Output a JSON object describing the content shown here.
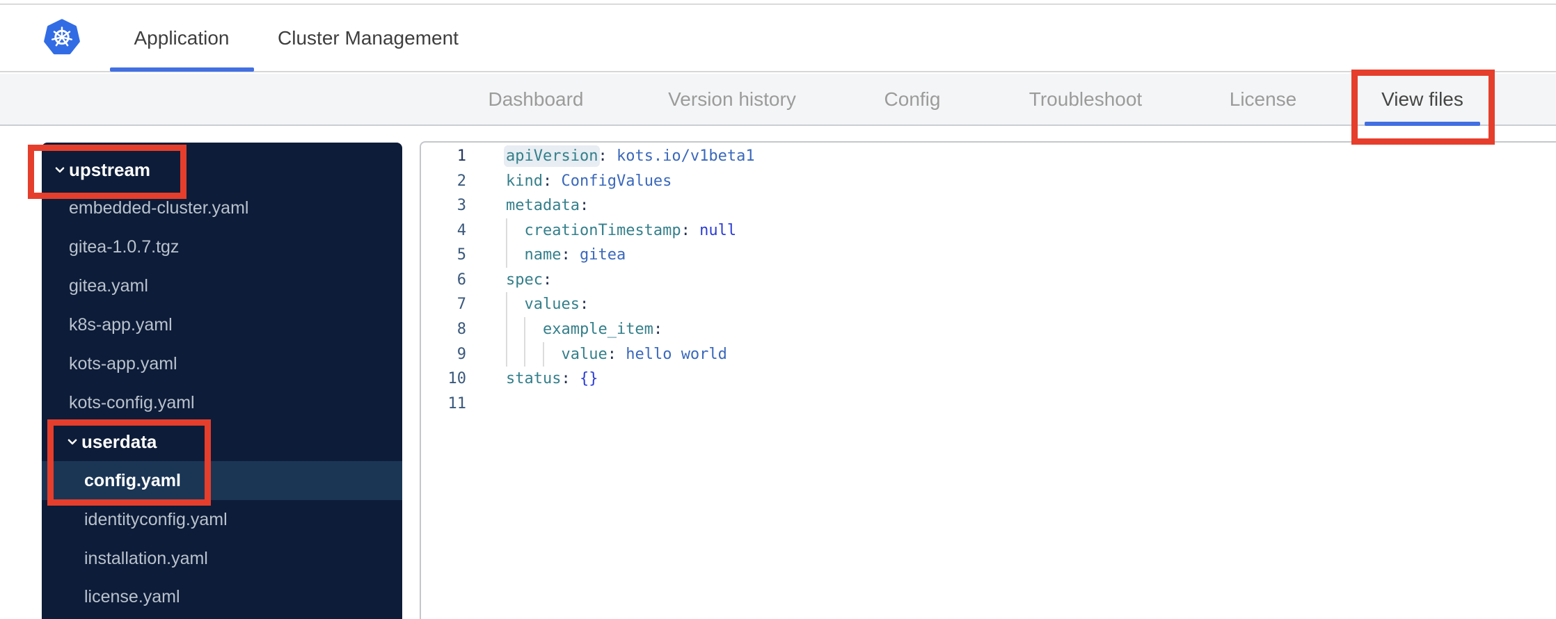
{
  "header": {
    "tabs": [
      {
        "label": "Application",
        "active": true
      },
      {
        "label": "Cluster Management",
        "active": false
      }
    ]
  },
  "nav": {
    "tabs": [
      {
        "label": "Dashboard",
        "active": false
      },
      {
        "label": "Version history",
        "active": false
      },
      {
        "label": "Config",
        "active": false
      },
      {
        "label": "Troubleshoot",
        "active": false
      },
      {
        "label": "License",
        "active": false
      },
      {
        "label": "View files",
        "active": true
      }
    ]
  },
  "sidebar": {
    "items": [
      {
        "label": "upstream",
        "type": "folder",
        "level": 0,
        "expanded": true,
        "selected": false
      },
      {
        "label": "embedded-cluster.yaml",
        "type": "file",
        "level": 1,
        "selected": false
      },
      {
        "label": "gitea-1.0.7.tgz",
        "type": "file",
        "level": 1,
        "selected": false
      },
      {
        "label": "gitea.yaml",
        "type": "file",
        "level": 1,
        "selected": false
      },
      {
        "label": "k8s-app.yaml",
        "type": "file",
        "level": 1,
        "selected": false
      },
      {
        "label": "kots-app.yaml",
        "type": "file",
        "level": 1,
        "selected": false
      },
      {
        "label": "kots-config.yaml",
        "type": "file",
        "level": 1,
        "selected": false
      },
      {
        "label": "userdata",
        "type": "folder",
        "level": 1,
        "expanded": true,
        "selected": false
      },
      {
        "label": "config.yaml",
        "type": "file",
        "level": 2,
        "selected": true
      },
      {
        "label": "identityconfig.yaml",
        "type": "file",
        "level": 2,
        "selected": false
      },
      {
        "label": "installation.yaml",
        "type": "file",
        "level": 2,
        "selected": false
      },
      {
        "label": "license.yaml",
        "type": "file",
        "level": 2,
        "selected": false
      }
    ]
  },
  "editor": {
    "selected_file": "config.yaml",
    "lines": [
      {
        "num": "1",
        "active": true,
        "guides": 0,
        "tokens": [
          {
            "c": "key",
            "t": "apiVersion",
            "hl": true
          },
          {
            "c": "punct",
            "t": ":"
          },
          {
            "c": "plain",
            "t": " "
          },
          {
            "c": "str",
            "t": "kots.io/v1beta1"
          }
        ]
      },
      {
        "num": "2",
        "active": false,
        "guides": 0,
        "tokens": [
          {
            "c": "key",
            "t": "kind"
          },
          {
            "c": "punct",
            "t": ":"
          },
          {
            "c": "plain",
            "t": " "
          },
          {
            "c": "str",
            "t": "ConfigValues"
          }
        ]
      },
      {
        "num": "3",
        "active": false,
        "guides": 0,
        "tokens": [
          {
            "c": "key",
            "t": "metadata"
          },
          {
            "c": "punct",
            "t": ":"
          }
        ]
      },
      {
        "num": "4",
        "active": false,
        "guides": 1,
        "tokens": [
          {
            "c": "plain",
            "t": "  "
          },
          {
            "c": "key",
            "t": "creationTimestamp"
          },
          {
            "c": "punct",
            "t": ":"
          },
          {
            "c": "plain",
            "t": " "
          },
          {
            "c": "atom",
            "t": "null"
          }
        ]
      },
      {
        "num": "5",
        "active": false,
        "guides": 1,
        "tokens": [
          {
            "c": "plain",
            "t": "  "
          },
          {
            "c": "key",
            "t": "name"
          },
          {
            "c": "punct",
            "t": ":"
          },
          {
            "c": "plain",
            "t": " "
          },
          {
            "c": "str",
            "t": "gitea"
          }
        ]
      },
      {
        "num": "6",
        "active": false,
        "guides": 0,
        "tokens": [
          {
            "c": "key",
            "t": "spec"
          },
          {
            "c": "punct",
            "t": ":"
          }
        ]
      },
      {
        "num": "7",
        "active": false,
        "guides": 1,
        "tokens": [
          {
            "c": "plain",
            "t": "  "
          },
          {
            "c": "key",
            "t": "values"
          },
          {
            "c": "punct",
            "t": ":"
          }
        ]
      },
      {
        "num": "8",
        "active": false,
        "guides": 2,
        "tokens": [
          {
            "c": "plain",
            "t": "    "
          },
          {
            "c": "key",
            "t": "example_item"
          },
          {
            "c": "punct",
            "t": ":"
          }
        ]
      },
      {
        "num": "9",
        "active": false,
        "guides": 3,
        "tokens": [
          {
            "c": "plain",
            "t": "      "
          },
          {
            "c": "key",
            "t": "value"
          },
          {
            "c": "punct",
            "t": ":"
          },
          {
            "c": "plain",
            "t": " "
          },
          {
            "c": "str",
            "t": "hello world"
          }
        ]
      },
      {
        "num": "10",
        "active": false,
        "guides": 0,
        "tokens": [
          {
            "c": "key",
            "t": "status"
          },
          {
            "c": "punct",
            "t": ":"
          },
          {
            "c": "plain",
            "t": " "
          },
          {
            "c": "atom",
            "t": "{}"
          }
        ]
      },
      {
        "num": "11",
        "active": false,
        "guides": 0,
        "tokens": []
      }
    ]
  },
  "annotations": {
    "color": "#e53e2c",
    "boxes": [
      {
        "target": "view-files-tab"
      },
      {
        "target": "upstream-folder"
      },
      {
        "target": "userdata-folder-and-config-yaml"
      }
    ]
  },
  "colors": {
    "accent_blue": "#4270e2",
    "annotation_red": "#e53e2c",
    "k8s_blue": "#326ce5",
    "sidebar_bg": "#0d1c38",
    "sidebar_highlight": "#1b3655",
    "sidebar_file_text": "#b9c2cd",
    "nav_bg": "#f4f5f6",
    "nav_text": "#9b9b9b",
    "nav_text_active": "#454545",
    "code_key": "#347f8b",
    "code_punct": "#24314f",
    "code_string": "#3a68bb",
    "code_atom": "#2b3cd5",
    "code_linenum": "#3a587c"
  }
}
